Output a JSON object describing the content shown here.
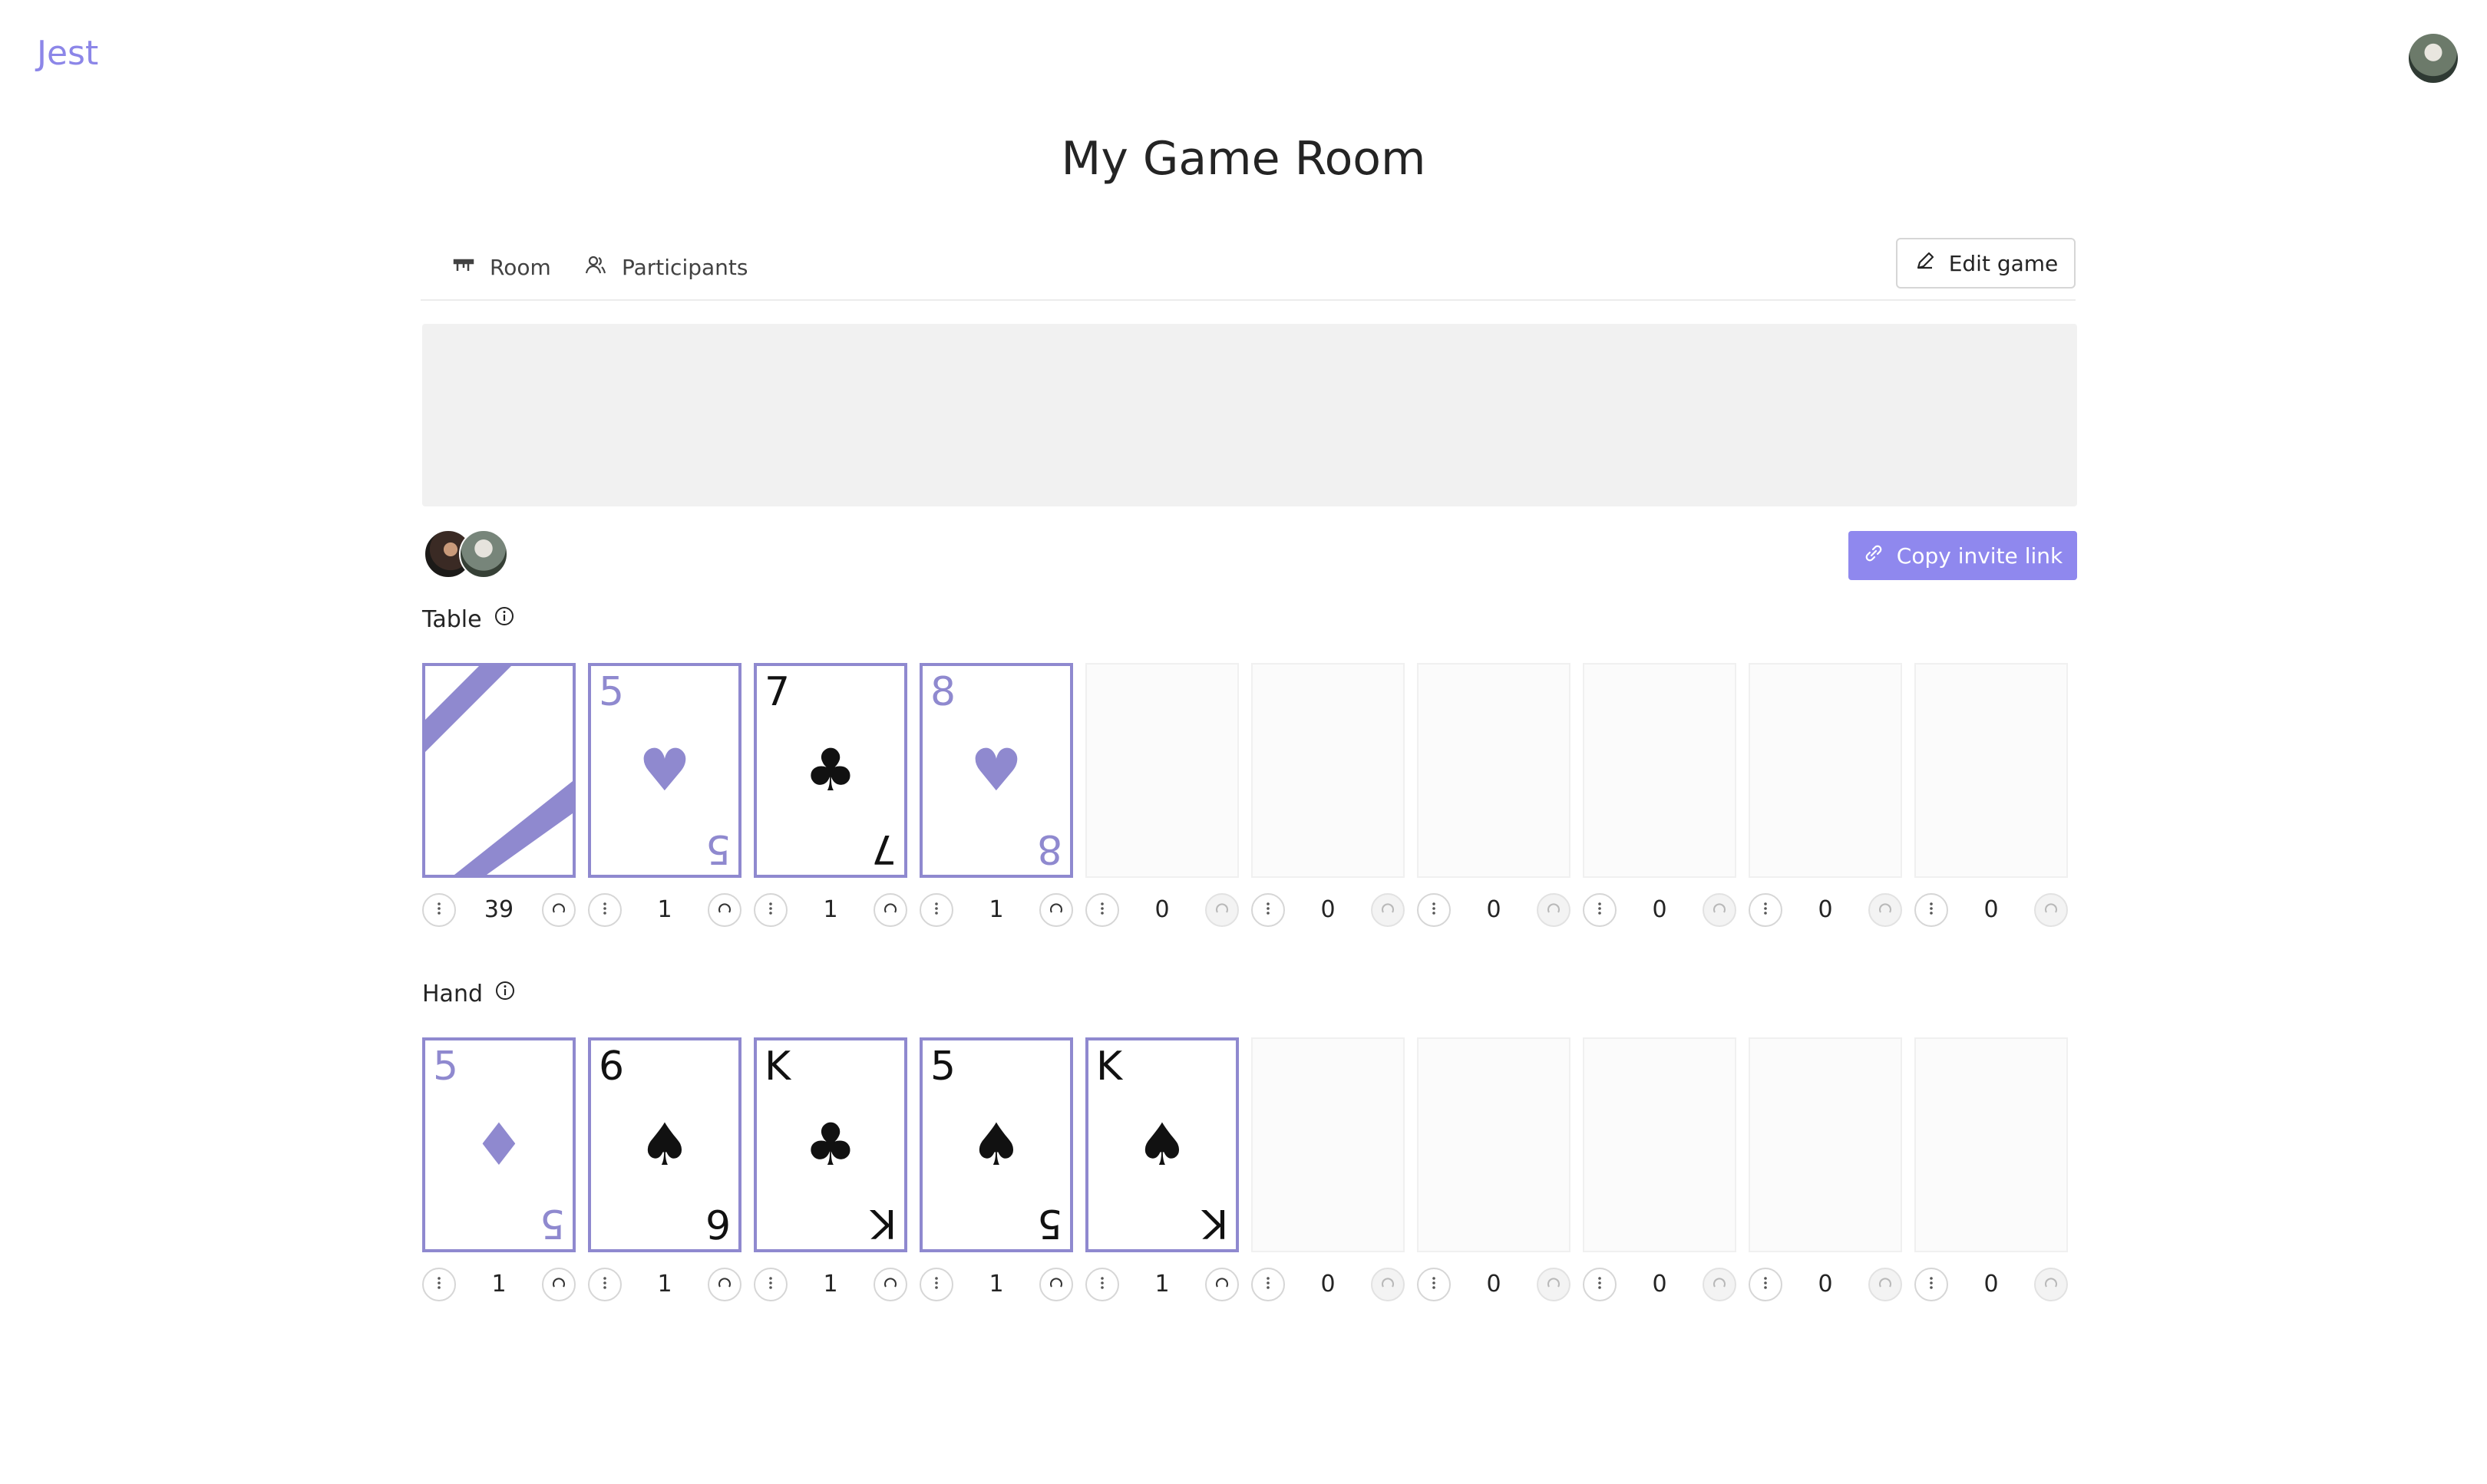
{
  "app": {
    "brand": "Jest"
  },
  "page": {
    "title": "My Game Room"
  },
  "tabs": [
    {
      "label": "Room",
      "icon": "table-icon"
    },
    {
      "label": "Participants",
      "icon": "people-icon"
    }
  ],
  "edit_game_label": "Edit game",
  "invite_label": "Copy invite link",
  "table": {
    "label": "Table",
    "slots": [
      {
        "type": "back",
        "count": "39"
      },
      {
        "type": "card",
        "rank": "5",
        "suit": "♥",
        "color": "red",
        "count": "1"
      },
      {
        "type": "card",
        "rank": "7",
        "suit": "♣",
        "color": "black",
        "count": "1"
      },
      {
        "type": "card",
        "rank": "8",
        "suit": "♥",
        "color": "red",
        "count": "1"
      },
      {
        "type": "empty",
        "count": "0"
      },
      {
        "type": "empty",
        "count": "0"
      },
      {
        "type": "empty",
        "count": "0"
      },
      {
        "type": "empty",
        "count": "0"
      },
      {
        "type": "empty",
        "count": "0"
      },
      {
        "type": "empty",
        "count": "0"
      }
    ]
  },
  "hand": {
    "label": "Hand",
    "slots": [
      {
        "type": "card",
        "rank": "5",
        "suit": "♦",
        "color": "red",
        "count": "1"
      },
      {
        "type": "card",
        "rank": "6",
        "suit": "♠",
        "color": "black",
        "count": "1"
      },
      {
        "type": "card",
        "rank": "K",
        "suit": "♣",
        "color": "black",
        "count": "1"
      },
      {
        "type": "card",
        "rank": "5",
        "suit": "♠",
        "color": "black",
        "count": "1"
      },
      {
        "type": "card",
        "rank": "K",
        "suit": "♠",
        "color": "black",
        "count": "1"
      },
      {
        "type": "empty",
        "count": "0"
      },
      {
        "type": "empty",
        "count": "0"
      },
      {
        "type": "empty",
        "count": "0"
      },
      {
        "type": "empty",
        "count": "0"
      },
      {
        "type": "empty",
        "count": "0"
      }
    ]
  },
  "colors": {
    "accent": "#8f88ee",
    "card_red": "#8f89cf",
    "card_black": "#111111"
  }
}
